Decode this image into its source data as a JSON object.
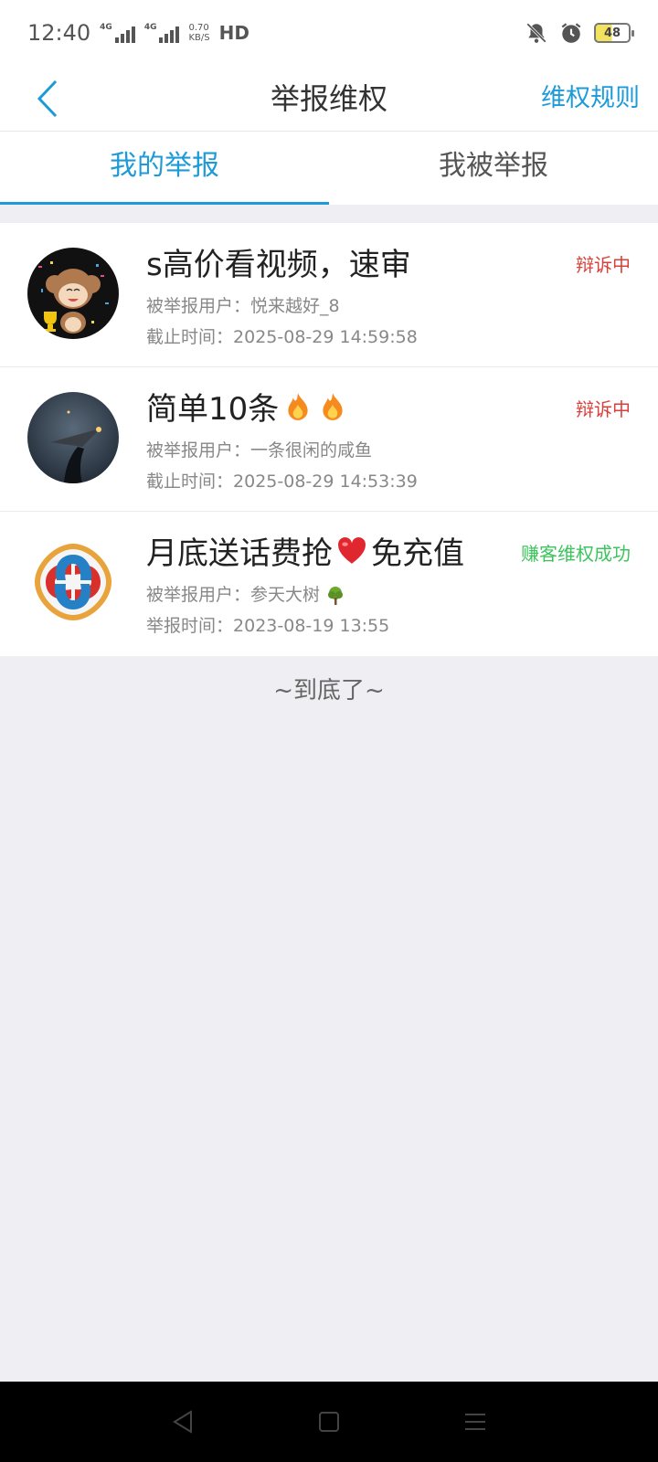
{
  "status_bar": {
    "time": "12:40",
    "signal1_label": "4G",
    "signal2_label": "4G",
    "speed_value": "0.70",
    "speed_unit": "KB/S",
    "hd": "HD",
    "battery": "48"
  },
  "header": {
    "title": "举报维权",
    "rules_label": "维权规则"
  },
  "tabs": [
    {
      "label": "我的举报",
      "active": true
    },
    {
      "label": "我被举报",
      "active": false
    }
  ],
  "reports": [
    {
      "title": "s高价看视频，速审",
      "status": "辩诉中",
      "user_label": "被举报用户：",
      "user": "悦来越好_8",
      "time_label": "截止时间：",
      "time": "2025-08-29 14:59:58"
    },
    {
      "title": "简单10条",
      "status": "辩诉中",
      "user_label": "被举报用户：",
      "user": "一条很闲的咸鱼",
      "time_label": "截止时间：",
      "time": "2025-08-29 14:53:39"
    },
    {
      "title_part1": "月底送话费抢",
      "title_part2": "免充值",
      "status": "赚客维权成功",
      "user_label": "被举报用户：",
      "user": "参天大树",
      "time_label": "举报时间：",
      "time": "2023-08-19 13:55"
    }
  ],
  "end_note": "~到底了~",
  "colors": {
    "accent": "#1d9bd8",
    "status_pending": "#d9403a",
    "status_success": "#3cc45d",
    "background": "#eeeef3"
  }
}
